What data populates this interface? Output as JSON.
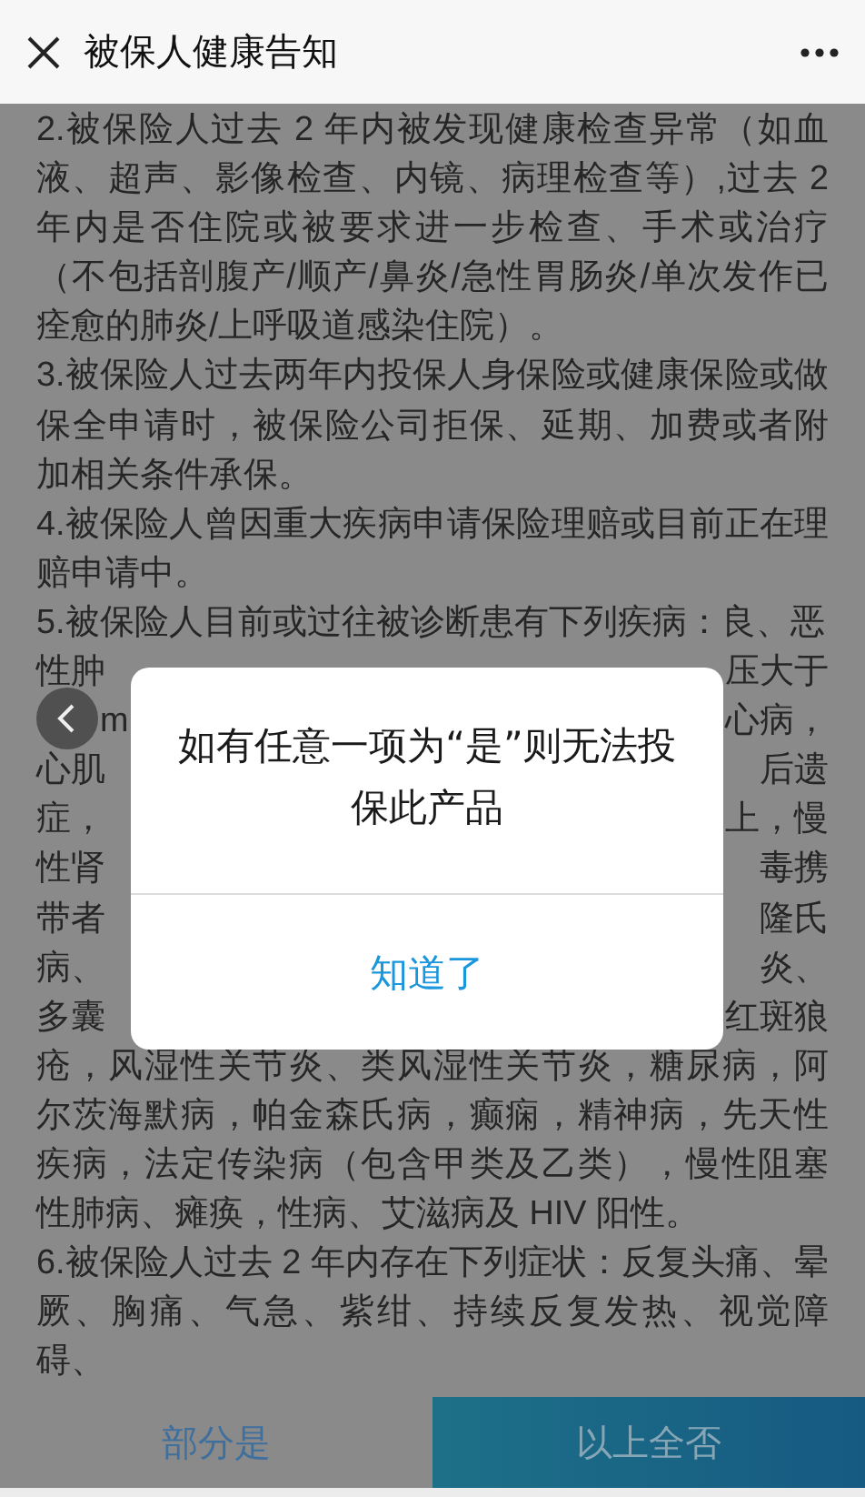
{
  "header": {
    "title": "被保人健康告知"
  },
  "sections": [
    {
      "kind": "text",
      "text": "2.被保险人过去 2 年内被发现健康检查异常（如血液、超声、影像检查、内镜、病理检查等）,过去 2 年内是否住院或被要求进一步检查、手术或治疗（不包括剖腹产/顺产/鼻炎/急性胃肠炎/单次发作已痊愈的肺炎/上呼吸道感染住院）。"
    },
    {
      "kind": "text",
      "text": "3.被保险人过去两年内投保人身保险或健康保险或做保全申请时，被保险公司拒保、延期、加费或者附加相关条件承保。"
    },
    {
      "kind": "text",
      "text": "4.被保险人曾因重大疾病申请保险理赔或目前正在理赔申请中。"
    },
    {
      "kind": "text",
      "text": "5.被保险人目前或过往被诊断患有下列疾病：良、恶"
    },
    {
      "kind": "covered",
      "lines": [
        {
          "left": "性肿",
          "right": "压大于"
        },
        {
          "left": "m",
          "right": "心病，",
          "behind_button": true
        },
        {
          "left": "心肌",
          "right": "后遗"
        },
        {
          "left": "症，",
          "right": "上，慢"
        },
        {
          "left": "性肾",
          "right": "毒携"
        },
        {
          "left": "带者",
          "right": "隆氏"
        },
        {
          "left": "病、",
          "right": "炎、"
        },
        {
          "left": "多囊",
          "right": "红斑狼"
        }
      ]
    },
    {
      "kind": "text",
      "text": "疮，风湿性关节炎、类风湿性关节炎，糖尿病，阿尔茨海默病，帕金森氏病，癫痫，精神病，先天性疾病，法定传染病（包含甲类及乙类），慢性阻塞性肺病、瘫痪，性病、艾滋病及 HIV 阳性。"
    },
    {
      "kind": "text",
      "text": "6.被保险人过去 2 年内存在下列症状：反复头痛、晕厥、胸痛、气急、紫绀、持续反复发热、视觉障碍、"
    }
  ],
  "dialog": {
    "message": "如有任意一项为“是”则无法投保此产品",
    "button": "知道了"
  },
  "footer": [
    {
      "label": "部分是",
      "kind": "secondary"
    },
    {
      "label": "以上全否",
      "kind": "primary"
    }
  ]
}
